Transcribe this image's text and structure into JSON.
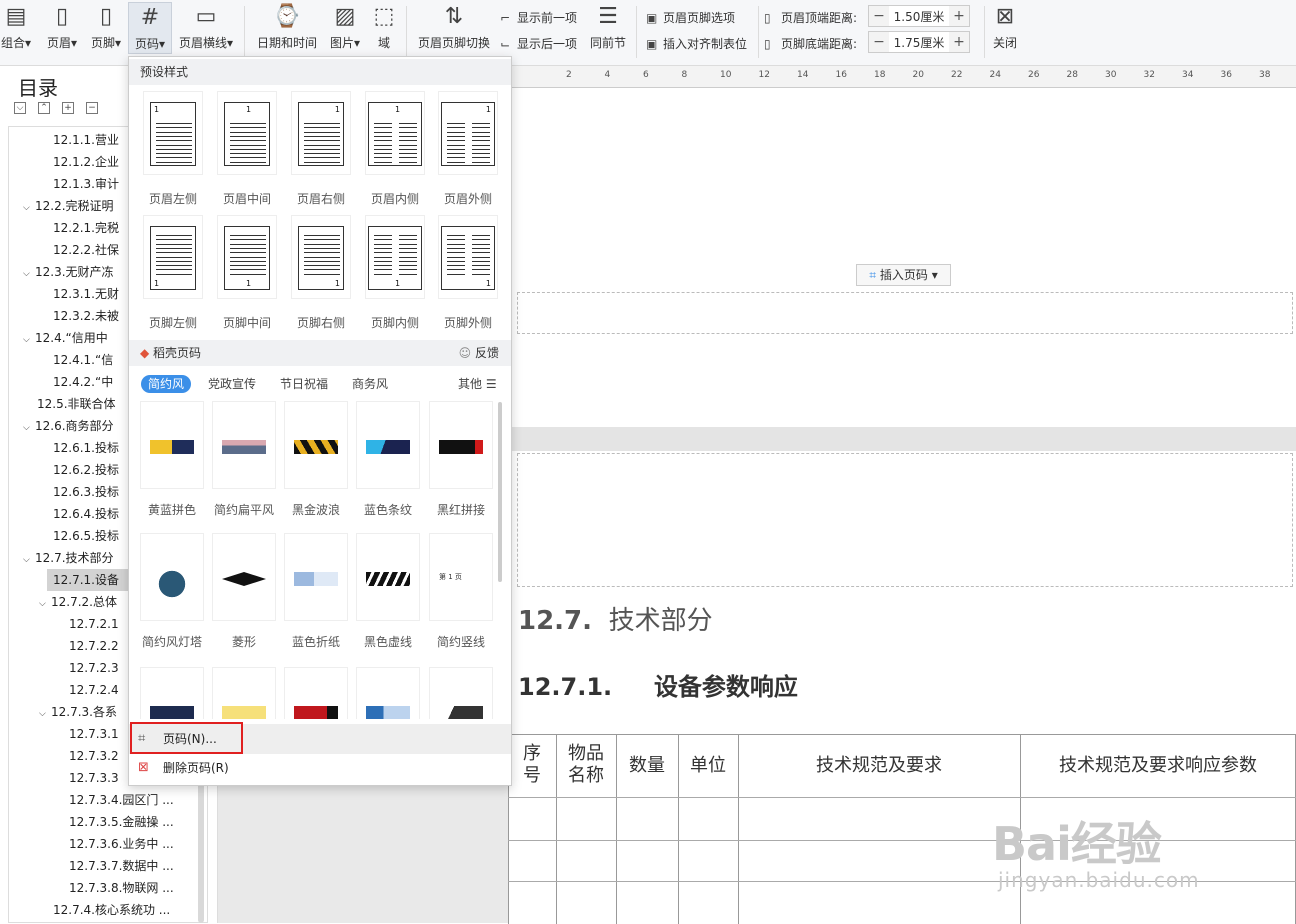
{
  "ribbon": {
    "combine": "组合",
    "header": "页眉",
    "footer": "页脚",
    "page_number": "页码",
    "header_line": "页眉横线",
    "datetime": "日期和时间",
    "picture": "图片",
    "field": "域",
    "switch": "页眉页脚切换",
    "show_prev": "显示前一项",
    "show_next": "显示后一项",
    "same_prev": "同前节",
    "hf_options": "页眉页脚选项",
    "insert_align_tab": "插入对齐制表位",
    "header_top_label": "页眉顶端距离:",
    "header_top_value": "1.50厘米",
    "footer_bottom_label": "页脚底端距离:",
    "footer_bottom_value": "1.75厘米",
    "close": "关闭",
    "minus": "−",
    "plus": "+"
  },
  "toc": {
    "title": "目录",
    "items": [
      {
        "text": "12.1.1.营业",
        "level": 2
      },
      {
        "text": "12.1.2.企业",
        "level": 2
      },
      {
        "text": "12.1.3.审计",
        "level": 2
      },
      {
        "text": "12.2.完税证明",
        "level": 1,
        "arrow": "⌵"
      },
      {
        "text": "12.2.1.完税",
        "level": 2
      },
      {
        "text": "12.2.2.社保",
        "level": 2
      },
      {
        "text": "12.3.无财产冻",
        "level": 1,
        "arrow": "⌵"
      },
      {
        "text": "12.3.1.无财",
        "level": 2
      },
      {
        "text": "12.3.2.未被",
        "level": 2
      },
      {
        "text": "12.4.“信用中",
        "level": 1,
        "arrow": "⌵"
      },
      {
        "text": "12.4.1.“信",
        "level": 2
      },
      {
        "text": "12.4.2.“中",
        "level": 2
      },
      {
        "text": "12.5.非联合体",
        "level": 1
      },
      {
        "text": "12.6.商务部分",
        "level": 1,
        "arrow": "⌵"
      },
      {
        "text": "12.6.1.投标",
        "level": 2
      },
      {
        "text": "12.6.2.投标",
        "level": 2
      },
      {
        "text": "12.6.3.投标",
        "level": 2
      },
      {
        "text": "12.6.4.投标",
        "level": 2
      },
      {
        "text": "12.6.5.投标",
        "level": 2
      },
      {
        "text": "12.7.技术部分",
        "level": 1,
        "arrow": "⌵"
      },
      {
        "text": "12.7.1.设备",
        "level": 2,
        "selected": true
      },
      {
        "text": "12.7.2.总体",
        "level": 2,
        "arrow": "⌵"
      },
      {
        "text": "12.7.2.1",
        "level": 3
      },
      {
        "text": "12.7.2.2",
        "level": 3
      },
      {
        "text": "12.7.2.3",
        "level": 3
      },
      {
        "text": "12.7.2.4",
        "level": 3
      },
      {
        "text": "12.7.3.各系",
        "level": 2,
        "arrow": "⌵"
      },
      {
        "text": "12.7.3.1",
        "level": 3
      },
      {
        "text": "12.7.3.2",
        "level": 3
      },
      {
        "text": "12.7.3.3",
        "level": 3
      },
      {
        "text": "12.7.3.4.园区门 ...",
        "level": 3
      },
      {
        "text": "12.7.3.5.金融操 ...",
        "level": 3
      },
      {
        "text": "12.7.3.6.业务中 ...",
        "level": 3
      },
      {
        "text": "12.7.3.7.数据中 ...",
        "level": 3
      },
      {
        "text": "12.7.3.8.物联网 ...",
        "level": 3
      },
      {
        "text": "12.7.4.核心系统功 ...",
        "level": 2
      }
    ]
  },
  "ruler": {
    "ticks": [
      "2",
      "4",
      "6",
      "8",
      "10",
      "12",
      "14",
      "16",
      "18",
      "20",
      "22",
      "24",
      "26",
      "28",
      "30",
      "32",
      "34",
      "36",
      "38"
    ]
  },
  "doc": {
    "insert_page_number": "插入页码",
    "heading1_num": "12.7.",
    "heading1_text": "技术部分",
    "heading2_num": "12.7.1.",
    "heading2_text": "设备参数响应",
    "table_headers": [
      "序\n号",
      "物品\n名称",
      "数量",
      "单位",
      "技术规范及要求",
      "技术规范及要求响应参数"
    ]
  },
  "menu": {
    "preset_title": "预设样式",
    "presets_row1": [
      "页眉左侧",
      "页眉中间",
      "页眉右侧",
      "页眉内侧",
      "页眉外侧"
    ],
    "presets_row2": [
      "页脚左侧",
      "页脚中间",
      "页脚右侧",
      "页脚内侧",
      "页脚外侧"
    ],
    "daoke_title": "稻壳页码",
    "feedback": "反馈",
    "tabs": [
      "简约风",
      "党政宣传",
      "节日祝福",
      "商务风"
    ],
    "other": "其他",
    "styles_row1": [
      "黄蓝拼色",
      "简约扁平风",
      "黑金波浪",
      "蓝色条纹",
      "黑红拼接"
    ],
    "styles_row2": [
      "简约风灯塔",
      "菱形",
      "蓝色折纸",
      "黑色虚线",
      "简约竖线"
    ],
    "item_page_number": "页码(N)...",
    "item_delete": "删除页码(R)",
    "page_num_digit": "1",
    "small_page_label": "第 1 页"
  },
  "watermark": {
    "logo": "Bai经验",
    "url": "jingyan.baidu.com"
  },
  "colors": {
    "accent": "#3b8fe8",
    "highlight": "#e02020",
    "selected": "#d3d3d3"
  }
}
